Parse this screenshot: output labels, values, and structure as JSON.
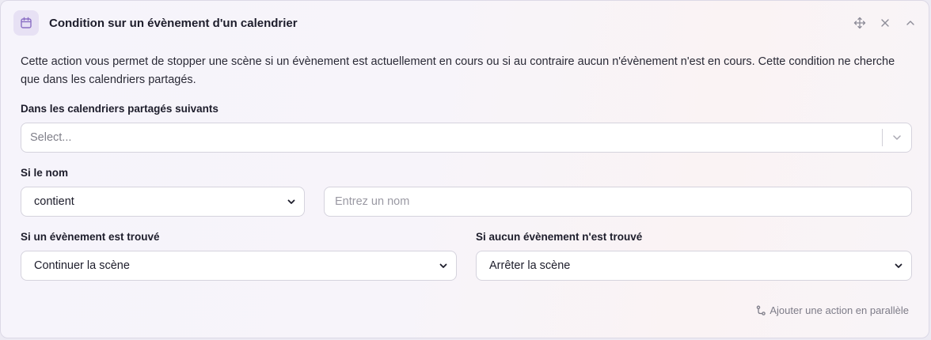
{
  "header": {
    "title": "Condition sur un évènement d'un calendrier",
    "icon": "calendar-icon",
    "actions": [
      "move-icon",
      "close-icon",
      "chevron-up-icon"
    ]
  },
  "description": "Cette action vous permet de stopper une scène si un évènement est actuellement en cours ou si au contraire aucun n'évènement n'est en cours. Cette condition ne cherche que dans les calendriers partagés.",
  "calendars": {
    "label": "Dans les calendriers partagés suivants",
    "placeholder": "Select..."
  },
  "name_filter": {
    "label": "Si le nom",
    "operator": "contient",
    "input_placeholder": "Entrez un nom"
  },
  "found": {
    "label": "Si un évènement est trouvé",
    "value": "Continuer la scène"
  },
  "not_found": {
    "label": "Si aucun évènement n'est trouvé",
    "value": "Arrêter la scène"
  },
  "footer": {
    "parallel_label": "Ajouter une action en parallèle"
  },
  "colors": {
    "accent": "#8a6fc4",
    "icon_bg": "#e7e1f4",
    "border": "#d5d3dd"
  }
}
